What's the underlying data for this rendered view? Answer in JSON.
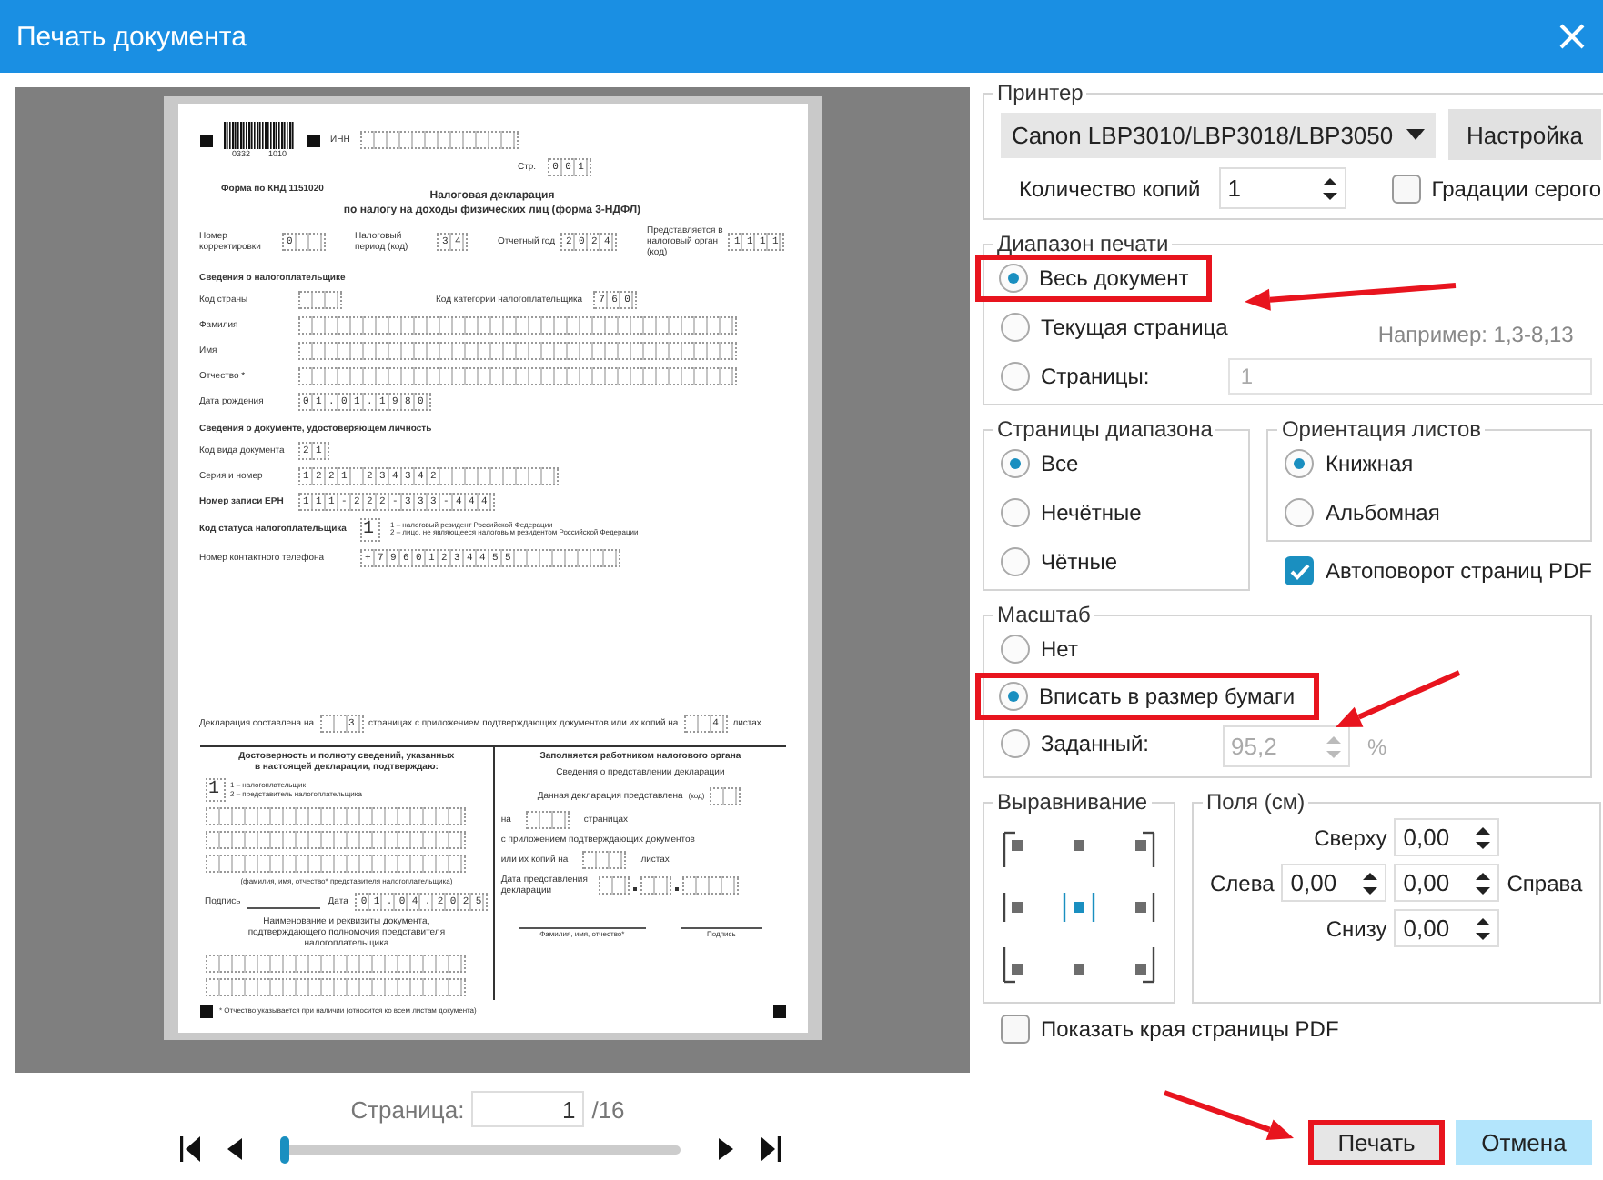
{
  "window": {
    "title": "Печать документа"
  },
  "document": {
    "barcode_digits": [
      "0332",
      "1010"
    ],
    "inn": {
      "label": "ИНН",
      "kind": "inn"
    },
    "page_no": {
      "label": "Стр.",
      "value": "001"
    },
    "form_code": "Форма по КНД 1151020",
    "title": [
      "Налоговая декларация",
      "по налогу на доходы физических лиц (форма 3-НДФЛ)"
    ],
    "head_fields": [
      {
        "label": "Номер корректировки",
        "value": "0",
        "kind": "three"
      },
      {
        "label": "Налоговый период (код)",
        "value": "34"
      },
      {
        "label": "Отчетный год",
        "value": "2024"
      },
      {
        "label": "Представляется в налоговый орган (код)",
        "value": "1111"
      }
    ],
    "sections": [
      {
        "heading": "Сведения о налогоплательщике",
        "rows": [
          [
            {
              "label": "Код страны",
              "kind": "three"
            },
            {
              "label": "Код категории налогоплательщика",
              "value": "760"
            }
          ],
          [
            {
              "label": "Фамилия",
              "kind": "name"
            }
          ],
          [
            {
              "label": "Имя",
              "kind": "name"
            }
          ],
          [
            {
              "label": "Отчество *",
              "kind": "name"
            }
          ],
          [
            {
              "label": "Дата рождения",
              "value": "01.01.1980"
            }
          ]
        ]
      },
      {
        "heading": "Сведения о документе, удостоверяющем личность",
        "rows": [
          [
            {
              "label": "Код вида документа",
              "value": "21"
            }
          ],
          [
            {
              "label": "Серия и номер",
              "value": "1221 234342",
              "kind": "series"
            }
          ],
          [
            {
              "label": "Номер записи ЕРН",
              "value": "111-222-333-444",
              "bold": true
            }
          ],
          [
            {
              "label": "Код статуса налогоплательщика",
              "value": "1",
              "kind": "big",
              "bold": true,
              "notes": [
                "1 – налоговый резидент Российской Федерации",
                "2 – лицо, не являющееся налоговым резидентом Российской Федерации"
              ]
            }
          ],
          [
            {
              "label": "Номер контактного телефона",
              "value": "+79601234455",
              "kind": "phone"
            }
          ]
        ]
      }
    ],
    "pages_line": {
      "before": "Декларация составлена на",
      "pages": "3",
      "middle": "страницах с приложением подтверждающих документов или их копий на",
      "sheets": "4",
      "after": "листах"
    },
    "confirm": {
      "title": [
        "Достоверность и полноту сведений, указанных",
        "в настоящей декларации, подтверждаю:"
      ],
      "code": "1",
      "notes": [
        "1 – налогоплательщик",
        "2 – представитель налогоплательщика"
      ],
      "name_caption": "(фамилия, имя, отчество* представителя налогоплательщика)",
      "sign_label": "Подпись",
      "date_label": "Дата",
      "date": "01.04.2025",
      "doc_caption": [
        "Наименование и реквизиты документа,",
        "подтверждающего полномочия представителя налогоплательщика"
      ]
    },
    "tax_office": {
      "title": "Заполняется работником налогового органа",
      "subtitle": "Сведения о представлении декларации",
      "submitted_label": "Данная декларация представлена",
      "code_label": "(код)",
      "on_label": "на",
      "pages_label": "страницах",
      "attach_label": "с приложением подтверждающих документов",
      "copies_label": "или их копий на",
      "sheets_label": "листах",
      "date_label": [
        "Дата представления",
        "декларации"
      ],
      "name_caption": "Фамилия, имя, отчество*",
      "sign_caption": "Подпись"
    },
    "footnote": "* Отчество указывается при наличии (относится ко всем листам документа)"
  },
  "pager": {
    "label": "Страница:",
    "value": "1",
    "total": "/16",
    "level": 0
  },
  "printer": {
    "legend": "Принтер",
    "device": "Canon LBP3010/LBP3018/LBP3050",
    "setup_button": "Настройка",
    "copies_label": "Количество копий",
    "copies": "1",
    "grayscale": {
      "label": "Градации серого",
      "checked": false
    }
  },
  "print_range": {
    "legend": "Диапазон печати",
    "options": [
      {
        "label": "Весь документ",
        "selected": true,
        "highlighted": true
      },
      {
        "label": "Текущая страница",
        "selected": false,
        "highlighted": false
      },
      {
        "label": "Страницы:",
        "selected": false,
        "highlighted": false
      }
    ],
    "example": "Например: 1,3-8,13",
    "pages_field": {
      "value": "1",
      "disabled": true
    }
  },
  "page_subset": {
    "legend": "Страницы диапазона",
    "options": [
      {
        "label": "Все",
        "selected": true
      },
      {
        "label": "Нечётные",
        "selected": false
      },
      {
        "label": "Чётные",
        "selected": false
      }
    ]
  },
  "orientation": {
    "legend": "Ориентация листов",
    "options": [
      {
        "label": "Книжная",
        "selected": true
      },
      {
        "label": "Альбомная",
        "selected": false
      }
    ]
  },
  "auto_rotate": {
    "label": "Автоповорот страниц PDF",
    "checked": true
  },
  "scale": {
    "legend": "Масштаб",
    "options": [
      {
        "label": "Нет",
        "selected": false,
        "highlighted": false
      },
      {
        "label": "Вписать в размер бумаги",
        "selected": true,
        "highlighted": true
      },
      {
        "label": "Заданный:",
        "selected": false,
        "highlighted": false
      }
    ],
    "custom_field": {
      "value": "95,2",
      "disabled": true
    },
    "unit": "%"
  },
  "alignment": {
    "legend": "Выравнивание",
    "cells": [
      {
        "selected": false
      },
      {
        "selected": false
      },
      {
        "selected": false
      },
      {
        "selected": false
      },
      {
        "selected": true
      },
      {
        "selected": false
      },
      {
        "selected": false
      },
      {
        "selected": false
      },
      {
        "selected": false
      }
    ]
  },
  "margins": {
    "legend": "Поля (см)",
    "top": {
      "label": "Сверху",
      "value": "0,00"
    },
    "left": {
      "label": "Слева",
      "value": "0,00"
    },
    "right": {
      "label": "Справа",
      "value": "0,00"
    },
    "bottom": {
      "label": "Снизу",
      "value": "0,00"
    }
  },
  "show_edges": {
    "label": "Показать края страницы PDF",
    "checked": false
  },
  "buttons": [
    {
      "label": "Печать",
      "kind": "default",
      "highlighted": true
    },
    {
      "label": "Отмена",
      "kind": "cancel",
      "highlighted": false
    }
  ],
  "annotations": [
    {
      "kind": "arrow_from_right"
    },
    {
      "kind": "arrow_from_upper_right"
    },
    {
      "kind": "arrow_from_left"
    }
  ]
}
